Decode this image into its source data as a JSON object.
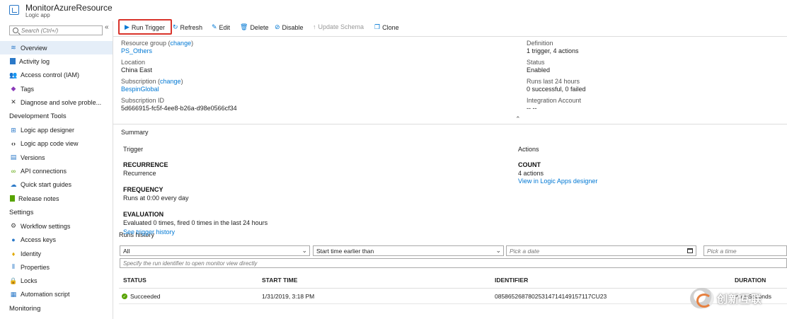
{
  "app": {
    "title": "MonitorAzureResource",
    "subtitle": "Logic app"
  },
  "sidebar": {
    "search_placeholder": "Search (Ctrl+/)",
    "collapse": "«",
    "items": [
      {
        "label": "Overview",
        "icon": "overview-icon"
      },
      {
        "label": "Activity log",
        "icon": "activity-log-icon"
      },
      {
        "label": "Access control (IAM)",
        "icon": "iam-icon"
      },
      {
        "label": "Tags",
        "icon": "tag-icon"
      },
      {
        "label": "Diagnose and solve proble...",
        "icon": "wrench-icon"
      }
    ],
    "sections": [
      {
        "title": "Development Tools",
        "items": [
          {
            "label": "Logic app designer",
            "icon": "designer-icon"
          },
          {
            "label": "Logic app code view",
            "icon": "code-icon"
          },
          {
            "label": "Versions",
            "icon": "versions-icon"
          },
          {
            "label": "API connections",
            "icon": "link-icon"
          },
          {
            "label": "Quick start guides",
            "icon": "quickstart-icon"
          },
          {
            "label": "Release notes",
            "icon": "notes-icon"
          }
        ]
      },
      {
        "title": "Settings",
        "items": [
          {
            "label": "Workflow settings",
            "icon": "gear-icon"
          },
          {
            "label": "Access keys",
            "icon": "key-icon"
          },
          {
            "label": "Identity",
            "icon": "identity-icon"
          },
          {
            "label": "Properties",
            "icon": "properties-icon"
          },
          {
            "label": "Locks",
            "icon": "lock-icon"
          },
          {
            "label": "Automation script",
            "icon": "script-icon"
          }
        ]
      },
      {
        "title": "Monitoring",
        "items": []
      }
    ]
  },
  "toolbar": {
    "run_trigger": "Run Trigger",
    "refresh": "Refresh",
    "edit": "Edit",
    "delete": "Delete",
    "disable": "Disable",
    "update_schema": "Update Schema",
    "clone": "Clone"
  },
  "essentials": {
    "resource_group_label": "Resource group",
    "change": "change",
    "resource_group_value": "PS_Others",
    "location_label": "Location",
    "location_value": "China East",
    "subscription_label": "Subscription",
    "subscription_value": "BespinGlobal",
    "subscription_id_label": "Subscription ID",
    "subscription_id_value": "5d666915-fc5f-4ee8-b26a-d98e0566cf34",
    "definition_label": "Definition",
    "definition_value": "1 trigger, 4 actions",
    "status_label": "Status",
    "status_value": "Enabled",
    "runs_label": "Runs last 24 hours",
    "runs_value": "0 successful, 0 failed",
    "integration_label": "Integration Account",
    "integration_value": "-- --"
  },
  "summary": {
    "title": "Summary",
    "trigger_label": "Trigger",
    "recurrence_h": "RECURRENCE",
    "recurrence_v": "Recurrence",
    "frequency_h": "FREQUENCY",
    "frequency_v": "Runs at 0:00 every day",
    "evaluation_h": "EVALUATION",
    "evaluation_v": "Evaluated 0 times, fired 0 times in the last 24 hours",
    "see_history": "See trigger history",
    "actions_label": "Actions",
    "count_h": "COUNT",
    "count_v": "4 actions",
    "designer_link": "View in Logic Apps designer"
  },
  "runs": {
    "title": "Runs history",
    "status_filter": "All",
    "time_filter": "Start time earlier than",
    "date_placeholder": "Pick a date",
    "time_placeholder": "Pick a time",
    "id_placeholder": "Specify the run identifier to open monitor view directly",
    "columns": [
      "STATUS",
      "START TIME",
      "IDENTIFIER",
      "DURATION"
    ],
    "rows": [
      {
        "status": "Succeeded",
        "start": "1/31/2019, 3:18 PM",
        "id": "08586526878025314714149157117CU23",
        "duration": "2.73 Seconds"
      }
    ]
  },
  "watermark": "创新互联"
}
